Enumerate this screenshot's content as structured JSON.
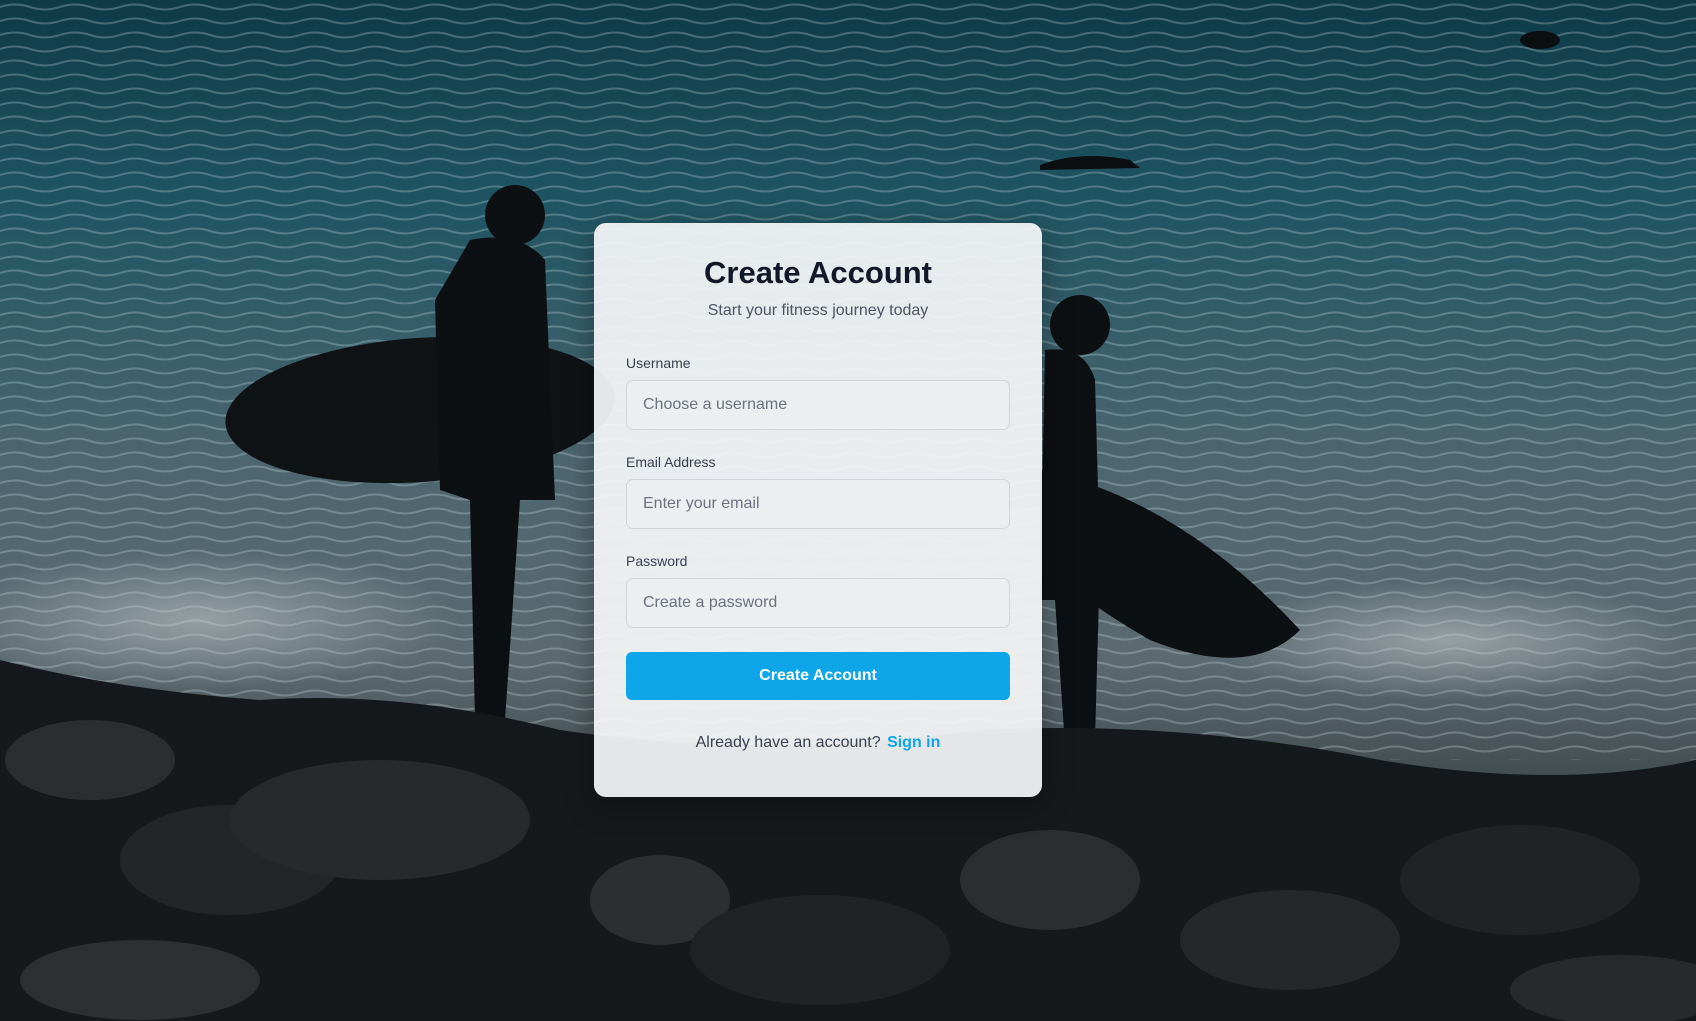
{
  "theme": {
    "accent": "#0ea5e9",
    "card_background": "#f5f6f7"
  },
  "background": {
    "icon": "surfers-beach-photo"
  },
  "signup": {
    "title": "Create Account",
    "subtitle": "Start your fitness journey today",
    "username": {
      "label": "Username",
      "value": "",
      "placeholder": "Choose a username"
    },
    "email": {
      "label": "Email Address",
      "value": "",
      "placeholder": "Enter your email"
    },
    "password": {
      "label": "Password",
      "value": "",
      "placeholder": "Create a password"
    },
    "submit_label": "Create Account",
    "footer_text": "Already have an account?",
    "signin_link": "Sign in"
  }
}
